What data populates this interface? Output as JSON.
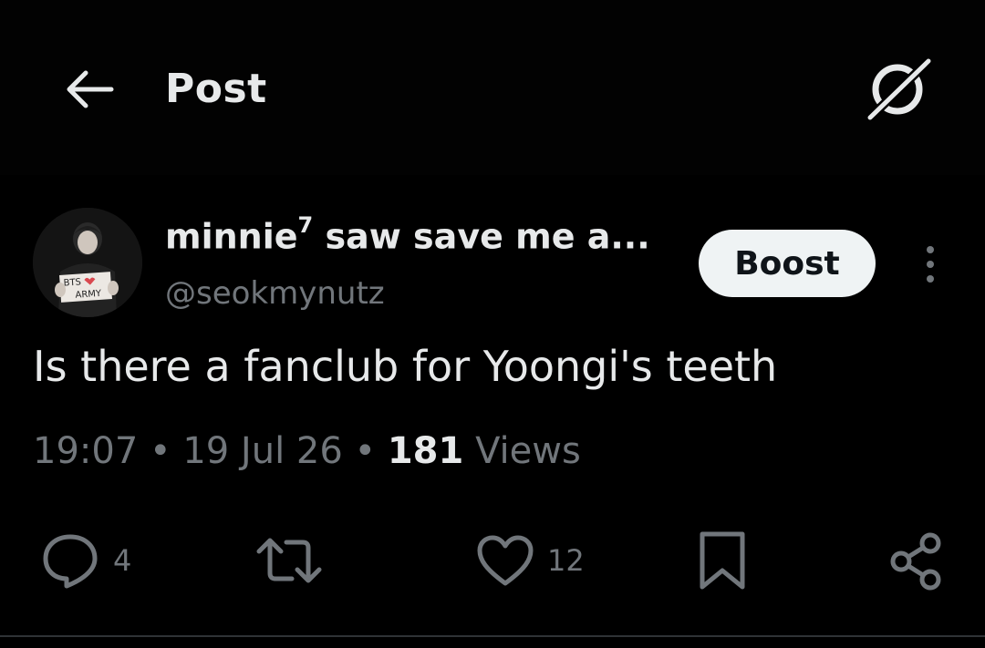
{
  "header": {
    "title": "Post",
    "back_icon": "arrow-left-icon",
    "grok_icon": "grok-icon"
  },
  "author": {
    "display_name": "minnie",
    "display_name_sup": "7",
    "display_name_rest": " saw save me a...",
    "handle": "@seokmynutz",
    "avatar_sign_text": "BTS ARMY"
  },
  "boost_label": "Boost",
  "post": {
    "text": "Is there a fanclub for Yoongi's teeth",
    "time": "19:07",
    "date": "19 Jul 26",
    "views_count": "181",
    "views_label": "Views"
  },
  "actions": {
    "reply_count": "4",
    "repost_count": "",
    "like_count": "12"
  },
  "colors": {
    "background": "#000000",
    "text_primary": "#e7e9ea",
    "text_secondary": "#71767b",
    "boost_bg": "#eff3f4",
    "divider": "#2f3336"
  }
}
